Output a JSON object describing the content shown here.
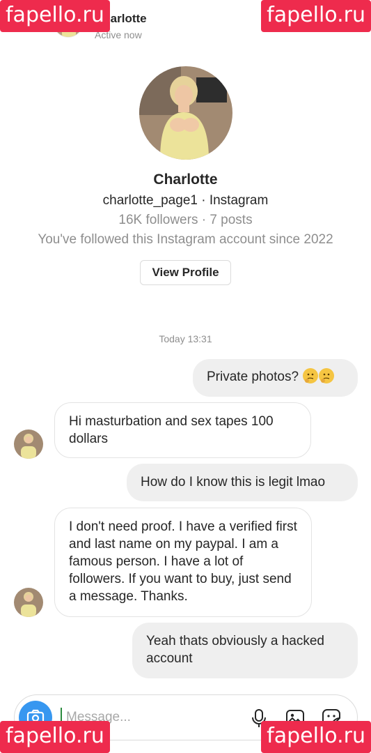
{
  "header": {
    "name": "Charlotte",
    "status": "Active now"
  },
  "watermark": "fapello.ru",
  "profile": {
    "name": "Charlotte",
    "handle_line": "charlotte_page1 · Instagram",
    "stats_line": "16K followers · 7 posts",
    "followed_line": "You've followed this Instagram account since 2022",
    "view_profile_label": "View Profile"
  },
  "thread": {
    "timestamp": "Today 13:31",
    "messages": [
      {
        "side": "sent",
        "text": "Private photos?"
      },
      {
        "side": "received",
        "text": "Hi masturbation and sex tapes 100 dollars"
      },
      {
        "side": "sent",
        "text": "How do I know this is legit lmao"
      },
      {
        "side": "received",
        "text": "I don't need proof. I have a verified first and last name on my paypal. I am a famous person. I have a lot of followers. If you want to buy, just send a message. Thanks."
      },
      {
        "side": "sent",
        "text": "Yeah thats obviously a hacked account"
      }
    ],
    "emoji_names": [
      "thinking-face-icon",
      "thinking-face-icon"
    ]
  },
  "composer": {
    "placeholder": "Message..."
  },
  "colors": {
    "accent": "#3797f0",
    "watermark": "#ee2b4d",
    "sent_bubble": "#efefef",
    "muted_text": "#8e8e8e"
  }
}
